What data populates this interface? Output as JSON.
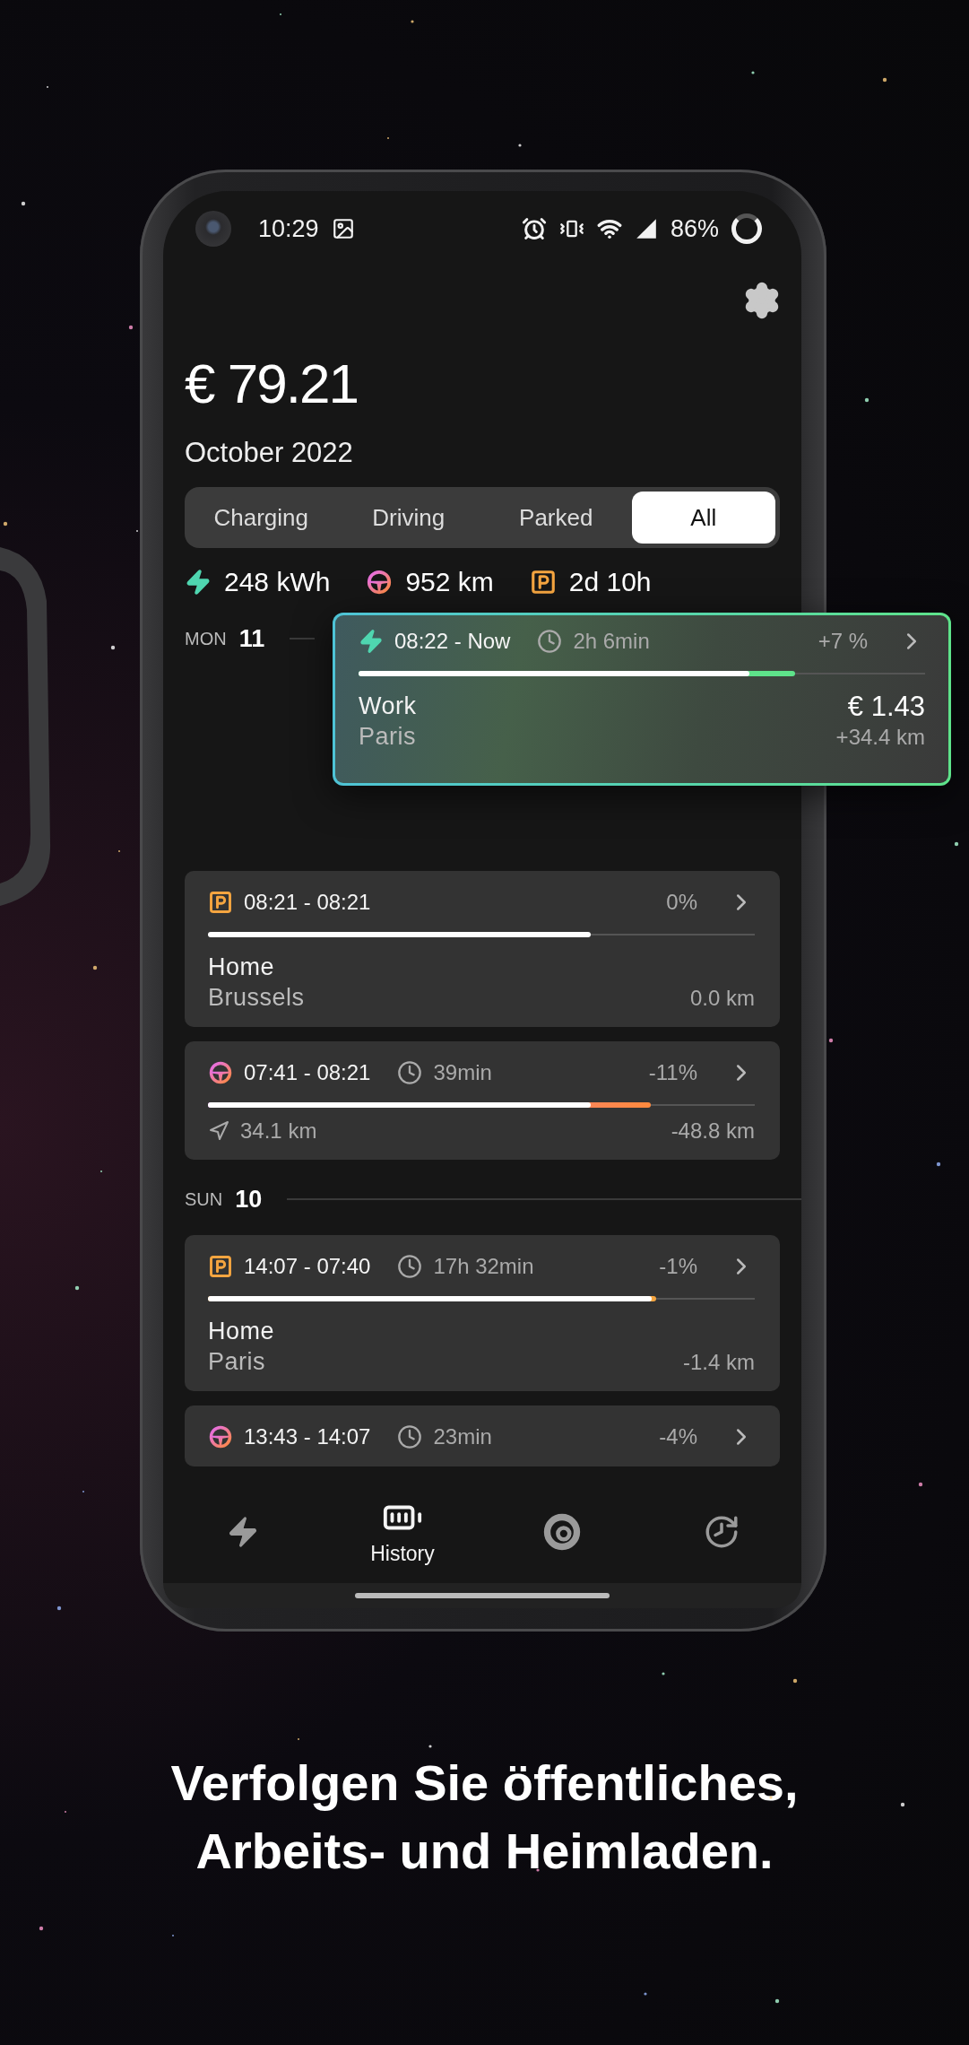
{
  "status_bar": {
    "time": "10:29",
    "battery": "86%"
  },
  "summary": {
    "total": "€ 79.21",
    "period": "October 2022"
  },
  "tabs": [
    {
      "label": "Charging",
      "selected": false
    },
    {
      "label": "Driving",
      "selected": false
    },
    {
      "label": "Parked",
      "selected": false
    },
    {
      "label": "All",
      "selected": true
    }
  ],
  "stats": [
    {
      "kind": "charging",
      "value": "248 kWh"
    },
    {
      "kind": "driving",
      "value": "952 km"
    },
    {
      "kind": "parked",
      "value": "2d 10h"
    }
  ],
  "days": [
    {
      "weekday": "MON",
      "day": "11",
      "sessions": [
        {
          "kind": "charging",
          "highlighted": true,
          "time": "08:22 - Now",
          "duration": "2h 6min",
          "change": "+7 %",
          "start_charge": {
            "level": 0.69
          },
          "end_charge": {
            "level": 0.77
          },
          "place": "Work",
          "city": "Paris",
          "cost": "€ 1.43",
          "distance": "+34.4 km"
        },
        {
          "kind": "parked",
          "highlighted": false,
          "time": "08:21 - 08:21",
          "change": "0%",
          "start_charge": {
            "level": 0.7
          },
          "end_charge": {
            "level": 0.7
          },
          "place": "Home",
          "city": "Brussels",
          "distance": "0.0 km"
        },
        {
          "kind": "driving",
          "highlighted": false,
          "time": "07:41 - 08:21",
          "duration": "39min",
          "change": "-11%",
          "start_charge": {
            "level": 0.81
          },
          "end_charge": {
            "level": 0.7
          },
          "trip": "34.1 km",
          "distance": "-48.8 km"
        }
      ]
    },
    {
      "weekday": "SUN",
      "day": "10",
      "sessions": [
        {
          "kind": "parked",
          "highlighted": false,
          "time": "14:07 - 07:40",
          "duration": "17h 32min",
          "change": "-1%",
          "start_charge": {
            "level": 0.82
          },
          "end_charge": {
            "level": 0.812
          },
          "place": "Home",
          "city": "Paris",
          "distance": "-1.4 km"
        },
        {
          "kind": "driving",
          "highlighted": false,
          "time": "13:43 - 14:07",
          "duration": "23min",
          "change": "-4%"
        }
      ]
    }
  ],
  "nav": [
    {
      "kind": "charging",
      "selected": false
    },
    {
      "kind": "history",
      "label": "History",
      "selected": true
    },
    {
      "kind": "stats",
      "selected": false
    },
    {
      "kind": "schedule",
      "selected": false
    }
  ],
  "caption": [
    "Verfolgen Sie öffentliches,",
    "Arbeits- und Heimladen."
  ]
}
